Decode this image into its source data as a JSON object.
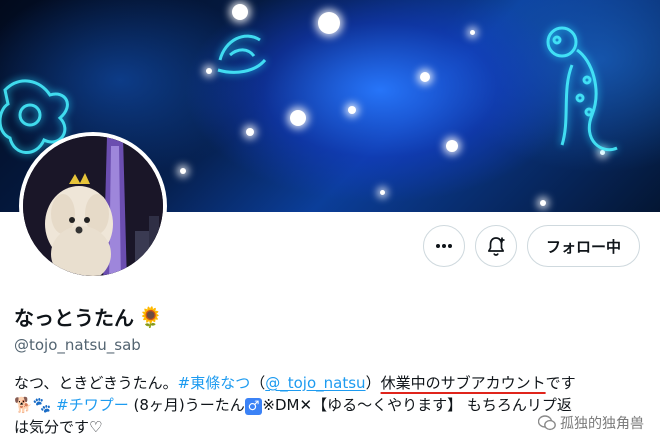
{
  "profile": {
    "name": "なっとうたん",
    "name_emoji": "🌻",
    "handle": "@tojo_natsu_sab"
  },
  "actions": {
    "more_icon": "more-dots-icon",
    "notify_icon": "bell-plus-icon",
    "follow_label": "フォロー中"
  },
  "bio": {
    "line1_a": "なつ、ときどきうたん。",
    "hashtag1": "#東條なつ",
    "paren_open": "（",
    "mention": "@_tojo_natsu",
    "paren_close": "）",
    "highlight": "休業中のサブアカウント",
    "line1_end": "です",
    "emoji_dog": "🐕",
    "emoji_paws": "🐾",
    "hashtag2": "#チワプー",
    "line2_a": " (8ヶ月)うーたん",
    "male_sign": "♂",
    "line2_b": "※DM",
    "cross": "✕",
    "line2_c": "【ゆる〜くやります】 もちろんリプ返",
    "line3": "は気分です♡"
  },
  "watermark": {
    "text": "孤独的独角兽"
  },
  "colors": {
    "link": "#1d9bf0",
    "handle": "#536471",
    "underline_mark": "#e0241b"
  }
}
